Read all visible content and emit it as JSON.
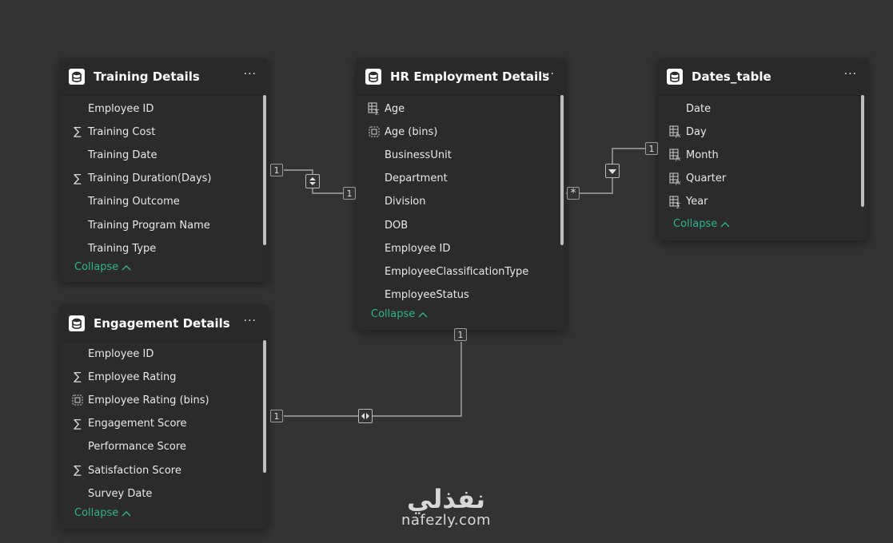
{
  "tables": {
    "training": {
      "title": "Training Details",
      "fields": [
        {
          "label": "Employee ID",
          "icon": "none"
        },
        {
          "label": "Training Cost",
          "icon": "sigma"
        },
        {
          "label": "Training Date",
          "icon": "none"
        },
        {
          "label": "Training Duration(Days)",
          "icon": "sigma"
        },
        {
          "label": "Training Outcome",
          "icon": "none"
        },
        {
          "label": "Training Program Name",
          "icon": "none"
        },
        {
          "label": "Training Type",
          "icon": "none"
        }
      ],
      "collapse_label": "Collapse"
    },
    "hr": {
      "title": "HR Employment Details",
      "fields": [
        {
          "label": "Age",
          "icon": "calc-sigma"
        },
        {
          "label": "Age (bins)",
          "icon": "bins"
        },
        {
          "label": "BusinessUnit",
          "icon": "none"
        },
        {
          "label": "Department",
          "icon": "none"
        },
        {
          "label": "Division",
          "icon": "none"
        },
        {
          "label": "DOB",
          "icon": "none"
        },
        {
          "label": "Employee ID",
          "icon": "none"
        },
        {
          "label": "EmployeeClassificationType",
          "icon": "none"
        },
        {
          "label": "EmployeeStatus",
          "icon": "none"
        }
      ],
      "collapse_label": "Collapse"
    },
    "dates": {
      "title": "Dates_table",
      "fields": [
        {
          "label": "Date",
          "icon": "none"
        },
        {
          "label": "Day",
          "icon": "calc-fx"
        },
        {
          "label": "Month",
          "icon": "calc-fx"
        },
        {
          "label": "Quarter",
          "icon": "calc-fx"
        },
        {
          "label": "Year",
          "icon": "calc-sigma"
        }
      ],
      "collapse_label": "Collapse"
    },
    "engagement": {
      "title": "Engagement Details",
      "fields": [
        {
          "label": "Employee ID",
          "icon": "none"
        },
        {
          "label": "Employee Rating",
          "icon": "sigma"
        },
        {
          "label": "Employee Rating (bins)",
          "icon": "bins"
        },
        {
          "label": "Engagement Score",
          "icon": "sigma"
        },
        {
          "label": "Performance Score",
          "icon": "none"
        },
        {
          "label": "Satisfaction Score",
          "icon": "sigma"
        },
        {
          "label": "Survey Date",
          "icon": "none"
        }
      ],
      "collapse_label": "Collapse"
    }
  },
  "more_menu_label": "···",
  "relationships": {
    "training_hr": {
      "from_card": "1",
      "to_card": "1",
      "direction": "both"
    },
    "dates_hr": {
      "from_card": "1",
      "to_card": "*",
      "direction": "single"
    },
    "engagement_hr": {
      "from_card": "1",
      "to_card": "1",
      "direction": "both"
    }
  },
  "watermark": {
    "arabic": "نفذلي",
    "latin": "nafezly.com"
  },
  "colors": {
    "background": "#333333",
    "card": "#2b2b2b",
    "collapse": "#2fb58b",
    "line": "#a8a8a8"
  }
}
